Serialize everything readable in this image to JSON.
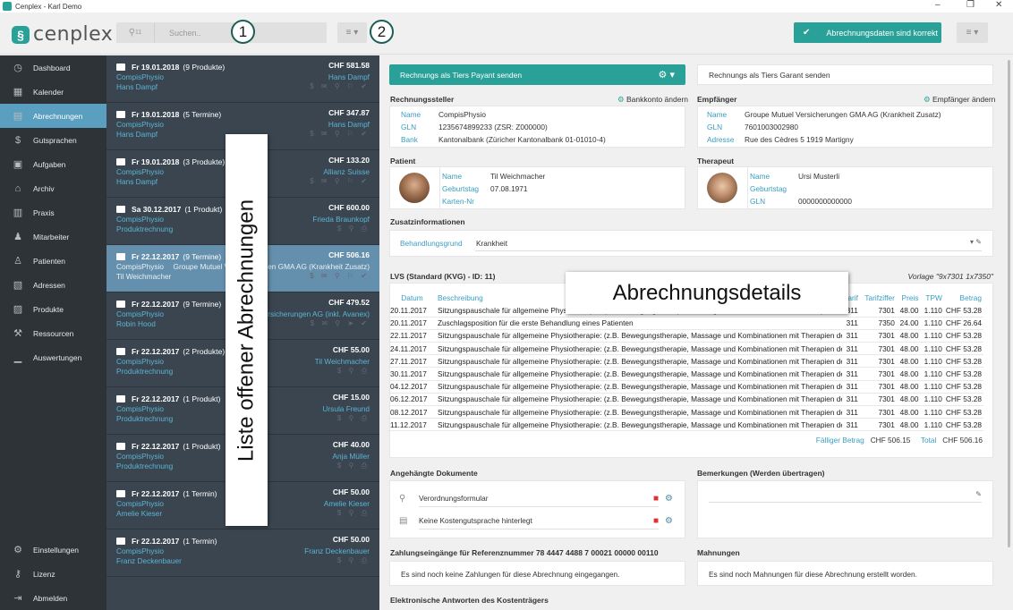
{
  "window": {
    "title": "Cenplex - Karl Demo",
    "controls": [
      "–",
      "❐",
      "✕"
    ]
  },
  "brand": {
    "name": "cenplex"
  },
  "topbar": {
    "filter_count": "11",
    "search_placeholder": "Suchen..",
    "badge1": "1",
    "badge2": "2",
    "confirm_label": "Abrechnungsdaten sind korrekt"
  },
  "sidebar": {
    "items": [
      {
        "label": "Dashboard",
        "icon": "◷"
      },
      {
        "label": "Kalender",
        "icon": "▦"
      },
      {
        "label": "Abrechnungen",
        "icon": "▤"
      },
      {
        "label": "Gutsprachen",
        "icon": "$"
      },
      {
        "label": "Aufgaben",
        "icon": "▣"
      },
      {
        "label": "Archiv",
        "icon": "⌂"
      },
      {
        "label": "Praxis",
        "icon": "▥"
      },
      {
        "label": "Mitarbeiter",
        "icon": "♟"
      },
      {
        "label": "Patienten",
        "icon": "♙"
      },
      {
        "label": "Adressen",
        "icon": "▧"
      },
      {
        "label": "Produkte",
        "icon": "▨"
      },
      {
        "label": "Ressourcen",
        "icon": "⚒"
      },
      {
        "label": "Auswertungen",
        "icon": "▁"
      }
    ],
    "bottom": [
      {
        "label": "Einstellungen",
        "icon": "⚙"
      },
      {
        "label": "Lizenz",
        "icon": "⚷"
      },
      {
        "label": "Abmelden",
        "icon": "⇥"
      }
    ]
  },
  "list": {
    "overlay_label": "Liste offener Abrechnungen",
    "items": [
      {
        "date": "Fr 19.01.2018",
        "count": "(9 Produkte)",
        "amount": "CHF 581.58",
        "left2": "CompisPhysio",
        "right2": "Hans Dampf",
        "left3": "Hans Dampf",
        "right3": "$ ✉ ⚲ ⚐ ✔"
      },
      {
        "date": "Fr 19.01.2018",
        "count": "(5 Termine)",
        "amount": "CHF 347.87",
        "left2": "CompisPhysio",
        "right2": "Hans Dampf",
        "left3": "Hans Dampf",
        "right3": "$ ✉ ⚲ ⚐ ✔"
      },
      {
        "date": "Fr 19.01.2018",
        "count": "(3 Produkte)",
        "amount": "CHF 133.20",
        "left2": "CompisPhysio",
        "right2": "Allianz Suisse",
        "left3": "Hans Dampf",
        "right3": "$ ✉ ⚲ ⚐ ✔"
      },
      {
        "date": "Sa 30.12.2017",
        "count": "(1 Produkt)",
        "amount": "CHF 600.00",
        "left2": "CompisPhysio",
        "right2": "Frieda Braunkopf",
        "left3": "Produktrechnung",
        "right3": "$ ⚲ ⎙"
      },
      {
        "date": "Fr 22.12.2017",
        "count": "(9 Termine)",
        "amount": "CHF 506.16",
        "left2": "CompisPhysio",
        "right2": "Groupe Mutuel Versicherungen GMA AG (Krankheit Zusatz)",
        "left3": "Til Weichmacher",
        "right3": "$ ✉ ⚲ ⚐ ✔"
      },
      {
        "date": "Fr 22.12.2017",
        "count": "(9 Termine)",
        "amount": "CHF 479.52",
        "left2": "CompisPhysio",
        "right2": "Helsana Versicherungen AG (inkl. Avanex)",
        "left3": "Robin Hood",
        "right3": "$ ✉ ⚲ ➤ ✔"
      },
      {
        "date": "Fr 22.12.2017",
        "count": "(2 Produkte)",
        "amount": "CHF 55.00",
        "left2": "CompisPhysio",
        "right2": "Til Weichmacher",
        "left3": "Produktrechnung",
        "right3": "$ ⚲ ⎙"
      },
      {
        "date": "Fr 22.12.2017",
        "count": "(1 Produkt)",
        "amount": "CHF 15.00",
        "left2": "CompisPhysio",
        "right2": "Ursula Freund",
        "left3": "Produktrechnung",
        "right3": "$ ⚲ ⎙"
      },
      {
        "date": "Fr 22.12.2017",
        "count": "(1 Produkt)",
        "amount": "CHF 40.00",
        "left2": "CompisPhysio",
        "right2": "Anja Müller",
        "left3": "Produktrechnung",
        "right3": "$ ⚲ ⎙"
      },
      {
        "date": "Fr 22.12.2017",
        "count": "(1 Termin)",
        "amount": "CHF 50.00",
        "left2": "CompisPhysio",
        "right2": "Amelie Kieser",
        "left3": "Amelie Kieser",
        "right3": "$ ⚲ ⎙"
      },
      {
        "date": "Fr 22.12.2017",
        "count": "(1 Termin)",
        "amount": "CHF 50.00",
        "left2": "CompisPhysio",
        "right2": "Franz Deckenbauer",
        "left3": "Franz Deckenbauer",
        "right3": "$ ⚲ ⎙"
      }
    ]
  },
  "detail": {
    "send_tiers_payant": "Rechnungs als Tiers Payant senden",
    "send_tiers_garant": "Rechnungs als Tiers Garant senden",
    "rechnungssteller": {
      "title": "Rechnungssteller",
      "action": "Bankkonto ändern",
      "rows": [
        {
          "k": "Name",
          "v": "CompisPhysio"
        },
        {
          "k": "GLN",
          "v": "1235674899233 (ZSR: Z000000)"
        },
        {
          "k": "Bank",
          "v": "Kantonalbank (Züricher Kantonalbank 01-01010-4)"
        }
      ]
    },
    "empfaenger": {
      "title": "Empfänger",
      "action": "Empfänger ändern",
      "rows": [
        {
          "k": "Name",
          "v": "Groupe Mutuel Versicherungen GMA AG (Krankheit Zusatz)"
        },
        {
          "k": "GLN",
          "v": "7601003002980"
        },
        {
          "k": "Adresse",
          "v": "Rue des Cèdres 5 1919 Martigny"
        }
      ]
    },
    "patient": {
      "title": "Patient",
      "rows": [
        {
          "k": "Name",
          "v": "Til Weichmacher"
        },
        {
          "k": "Geburtstag",
          "v": "07.08.1971"
        },
        {
          "k": "Karten-Nr",
          "v": ""
        }
      ]
    },
    "therapeut": {
      "title": "Therapeut",
      "rows": [
        {
          "k": "Name",
          "v": "Ursi Musterli"
        },
        {
          "k": "Geburtstag",
          "v": ""
        },
        {
          "k": "GLN",
          "v": "0000000000000"
        }
      ]
    },
    "zusatz": {
      "title": "Zusatzinformationen",
      "k": "Behandlungsgrund",
      "v": "Krankheit"
    },
    "lvs": {
      "title": "LVS (Standard (KVG) - ID: 11)",
      "vorlage": "Vorlage \"9x7301 1x7350\"",
      "headers": [
        "Datum",
        "Beschreibung",
        "Tarif",
        "Tarifziffer",
        "Preis",
        "TPW",
        "Betrag"
      ],
      "rows": [
        [
          "20.11.2017",
          "Sitzungspauschale für allgemeine Physiotherapie: (z.B. Bewegungstherapie, Massage und Kombinationen mit Therapien der...",
          "311",
          "7301",
          "48.00",
          "1.110",
          "CHF 53.28"
        ],
        [
          "20.11.2017",
          "Zuschlagsposition für die erste Behandlung eines Patienten",
          "311",
          "7350",
          "24.00",
          "1.110",
          "CHF 26.64"
        ],
        [
          "22.11.2017",
          "Sitzungspauschale für allgemeine Physiotherapie: (z.B. Bewegungstherapie, Massage und Kombinationen mit Therapien der...",
          "311",
          "7301",
          "48.00",
          "1.110",
          "CHF 53.28"
        ],
        [
          "24.11.2017",
          "Sitzungspauschale für allgemeine Physiotherapie: (z.B. Bewegungstherapie, Massage und Kombinationen mit Therapien der...",
          "311",
          "7301",
          "48.00",
          "1.110",
          "CHF 53.28"
        ],
        [
          "27.11.2017",
          "Sitzungspauschale für allgemeine Physiotherapie: (z.B. Bewegungstherapie, Massage und Kombinationen mit Therapien der...",
          "311",
          "7301",
          "48.00",
          "1.110",
          "CHF 53.28"
        ],
        [
          "30.11.2017",
          "Sitzungspauschale für allgemeine Physiotherapie: (z.B. Bewegungstherapie, Massage und Kombinationen mit Therapien der...",
          "311",
          "7301",
          "48.00",
          "1.110",
          "CHF 53.28"
        ],
        [
          "04.12.2017",
          "Sitzungspauschale für allgemeine Physiotherapie: (z.B. Bewegungstherapie, Massage und Kombinationen mit Therapien der...",
          "311",
          "7301",
          "48.00",
          "1.110",
          "CHF 53.28"
        ],
        [
          "06.12.2017",
          "Sitzungspauschale für allgemeine Physiotherapie: (z.B. Bewegungstherapie, Massage und Kombinationen mit Therapien der...",
          "311",
          "7301",
          "48.00",
          "1.110",
          "CHF 53.28"
        ],
        [
          "08.12.2017",
          "Sitzungspauschale für allgemeine Physiotherapie: (z.B. Bewegungstherapie, Massage und Kombinationen mit Therapien der...",
          "311",
          "7301",
          "48.00",
          "1.110",
          "CHF 53.28"
        ],
        [
          "11.12.2017",
          "Sitzungspauschale für allgemeine Physiotherapie: (z.B. Bewegungstherapie, Massage und Kombinationen mit Therapien der...",
          "311",
          "7301",
          "48.00",
          "1.110",
          "CHF 53.28"
        ]
      ],
      "due_label": "Fälliger Betrag",
      "due_value": "CHF 506.15",
      "total_label": "Total",
      "total_value": "CHF 506.16"
    },
    "overlay_label": "Abrechnungsdetails",
    "docs": {
      "title": "Angehängte Dokumente",
      "items": [
        "Verordnungsformular",
        "Keine Kostengutsprache hinterlegt"
      ]
    },
    "bemerkungen": {
      "title": "Bemerkungen (Werden übertragen)"
    },
    "zahlungen": {
      "title": "Zahlungseingänge für Referenznummer 78 4447 4488 7 00021 00000 00110",
      "text": "Es sind noch keine Zahlungen für diese Abrechnung eingegangen."
    },
    "mahnungen": {
      "title": "Mahnungen",
      "text": "Es sind noch Mahnungen für diese Abrechnung erstellt worden."
    },
    "elektronisch": {
      "title": "Elektronische Antworten des Kostenträgers"
    }
  }
}
